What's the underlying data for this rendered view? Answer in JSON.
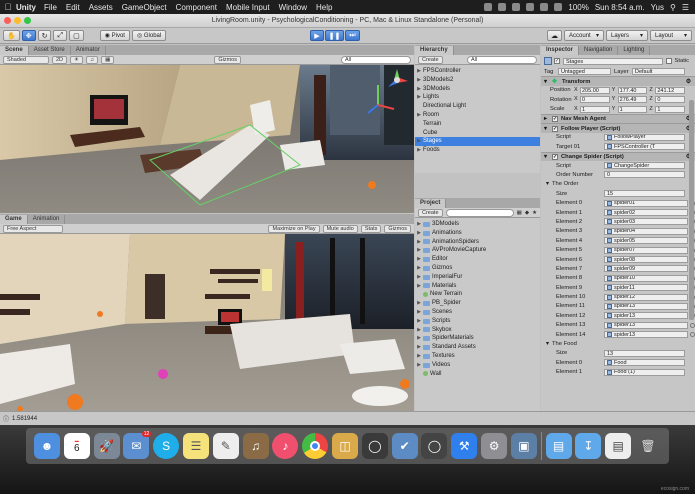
{
  "menubar": {
    "app": "Unity",
    "items": [
      "File",
      "Edit",
      "Assets",
      "GameObject",
      "Component",
      "Mobile Input",
      "Window",
      "Help"
    ],
    "battery": "100%",
    "clock": "Sun 8:54 a.m.",
    "user": "Yus"
  },
  "window": {
    "title": "LivingRoom.unity - PsychologicalConditioning - PC, Mac & Linux Standalone (Personal)"
  },
  "toolbar": {
    "pivot": "Pivot",
    "global": "Global",
    "account": "Account",
    "layers": "Layers",
    "layout": "Layout"
  },
  "scene": {
    "tabs": [
      "Scene",
      "Asset Store",
      "Animator"
    ],
    "shading": "Shaded",
    "mode": "2D",
    "gizmos": "Gizmos",
    "search": "All"
  },
  "game": {
    "tabs": [
      "Game",
      "Animation"
    ],
    "aspect": "Free Aspect",
    "options": [
      "Maximize on Play",
      "Mute audio",
      "Stats",
      "Gizmos"
    ]
  },
  "hierarchy": {
    "tab": "Hierarchy",
    "create": "Create",
    "search": "All",
    "items": [
      {
        "label": "FPSController",
        "arrow": true,
        "selected": false
      },
      {
        "label": "3DModels2",
        "arrow": true,
        "selected": false
      },
      {
        "label": "3DModels",
        "arrow": true,
        "selected": false
      },
      {
        "label": "Lights",
        "arrow": true,
        "selected": false
      },
      {
        "label": "Directional Light",
        "arrow": false,
        "selected": false
      },
      {
        "label": "Room",
        "arrow": true,
        "selected": false
      },
      {
        "label": "Terrain",
        "arrow": false,
        "selected": false
      },
      {
        "label": "Cube",
        "arrow": false,
        "selected": false
      },
      {
        "label": "Stages",
        "arrow": true,
        "selected": true
      },
      {
        "label": "Foods",
        "arrow": true,
        "selected": false
      }
    ]
  },
  "project": {
    "tab": "Project",
    "create": "Create",
    "items": [
      {
        "label": "3DModels",
        "folder": true
      },
      {
        "label": "Animations",
        "folder": true
      },
      {
        "label": "AnimationSpiders",
        "folder": true
      },
      {
        "label": "AVProMovieCapture",
        "folder": true
      },
      {
        "label": "Editor",
        "folder": true
      },
      {
        "label": "Gizmos",
        "folder": true
      },
      {
        "label": "ImperialFur",
        "folder": true
      },
      {
        "label": "Materials",
        "folder": true
      },
      {
        "label": "New Terrain",
        "folder": false
      },
      {
        "label": "PB_Spider",
        "folder": true
      },
      {
        "label": "Scenes",
        "folder": true
      },
      {
        "label": "Scripts",
        "folder": true
      },
      {
        "label": "Skybox",
        "folder": true
      },
      {
        "label": "SpiderMaterials",
        "folder": true
      },
      {
        "label": "Standard Assets",
        "folder": true
      },
      {
        "label": "Textures",
        "folder": true
      },
      {
        "label": "Videos",
        "folder": true
      },
      {
        "label": "Wall",
        "folder": false
      }
    ]
  },
  "inspector": {
    "tabs": [
      "Inspector",
      "Navigation",
      "Lighting"
    ],
    "object_name": "Stages",
    "static": "Static",
    "tag_label": "Tag",
    "tag": "Untagged",
    "layer_label": "Layer",
    "layer": "Default",
    "transform": {
      "title": "Transform",
      "position_label": "Position",
      "position": [
        "205.00",
        "177.40",
        "241.12"
      ],
      "rotation_label": "Rotation",
      "rotation": [
        "0",
        "276.49",
        "0"
      ],
      "scale_label": "Scale",
      "scale": [
        "1",
        "1",
        "1"
      ]
    },
    "nav_mesh_agent": "Nav Mesh Agent",
    "follow_player": {
      "title": "Follow Player (Script)",
      "script_label": "Script",
      "script": "FollowPlayer",
      "target_label": "Target 01",
      "target": "FPSController (T"
    },
    "change_spider": {
      "title": "Change Spider (Script)",
      "script_label": "Script",
      "script": "ChangeSpider",
      "order_label": "Order Number",
      "order": "0"
    },
    "the_order": {
      "title": "The Order",
      "size_label": "Size",
      "size": "15",
      "elements": [
        {
          "label": "Element 0",
          "value": "spider01"
        },
        {
          "label": "Element 1",
          "value": "spider02"
        },
        {
          "label": "Element 2",
          "value": "spider03"
        },
        {
          "label": "Element 3",
          "value": "spider04"
        },
        {
          "label": "Element 4",
          "value": "spider05"
        },
        {
          "label": "Element 5",
          "value": "spider07"
        },
        {
          "label": "Element 6",
          "value": "spider08"
        },
        {
          "label": "Element 7",
          "value": "spider09"
        },
        {
          "label": "Element 8",
          "value": "spider10"
        },
        {
          "label": "Element 9",
          "value": "spider11"
        },
        {
          "label": "Element 10",
          "value": "spider12"
        },
        {
          "label": "Element 11",
          "value": "spider13"
        },
        {
          "label": "Element 12",
          "value": "spider13"
        },
        {
          "label": "Element 13",
          "value": "spider13"
        },
        {
          "label": "Element 14",
          "value": "spider13"
        }
      ]
    },
    "the_food": {
      "title": "The Food",
      "size_label": "Size",
      "size": "13",
      "element0_label": "Element 0",
      "element0": "Food",
      "element1_label": "Element 1",
      "element1": "Food (1)"
    }
  },
  "status": "1.581944",
  "dock": {
    "calendar_day": "6",
    "mail_badge": "12",
    "watermark": "ecosign.com"
  }
}
